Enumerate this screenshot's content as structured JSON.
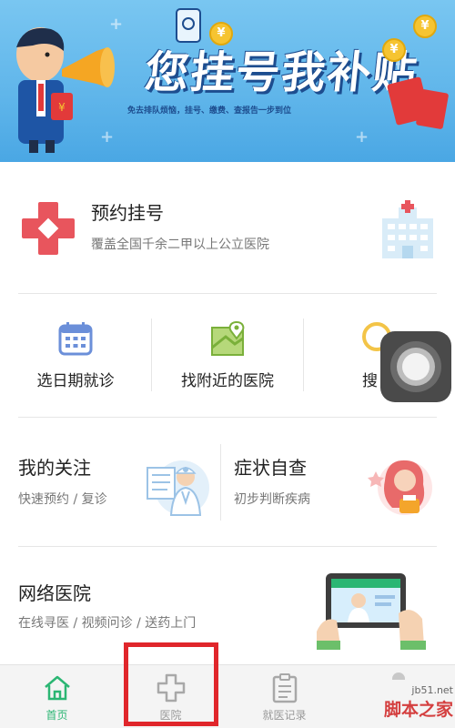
{
  "banner": {
    "title": "您挂号我补贴",
    "subtitle": "免去排队烦恼，挂号、缴费、查报告一步到位",
    "coin_symbol": "¥"
  },
  "appointment": {
    "title": "预约挂号",
    "subtitle": "覆盖全国千余二甲以上公立医院",
    "icon": "red-cross-icon",
    "illustration": "hospital-building-icon"
  },
  "quick_actions": [
    {
      "label": "选日期就诊",
      "icon": "calendar-icon"
    },
    {
      "label": "找附近的医院",
      "icon": "map-icon"
    },
    {
      "label": "搜",
      "icon": "search-icon"
    }
  ],
  "follow": {
    "title": "我的关注",
    "subtitle": "快速预约 / 复诊"
  },
  "symptom": {
    "title": "症状自查",
    "subtitle": "初步判断疾病"
  },
  "online": {
    "title": "网络医院",
    "subtitle": "在线寻医 / 视频问诊 / 送药上门"
  },
  "tabs": [
    {
      "label": "首页",
      "icon": "home-icon",
      "active": true
    },
    {
      "label": "医院",
      "icon": "hospital-cross-icon",
      "active": false
    },
    {
      "label": "就医记录",
      "icon": "clipboard-icon",
      "active": false
    }
  ],
  "watermark": {
    "line1": "jb51.net",
    "line2": "脚本之家"
  },
  "colors": {
    "accent": "#2bb673",
    "banner": "#5fb5ea",
    "highlight": "#e0262b",
    "brand_red": "#e8555d"
  }
}
